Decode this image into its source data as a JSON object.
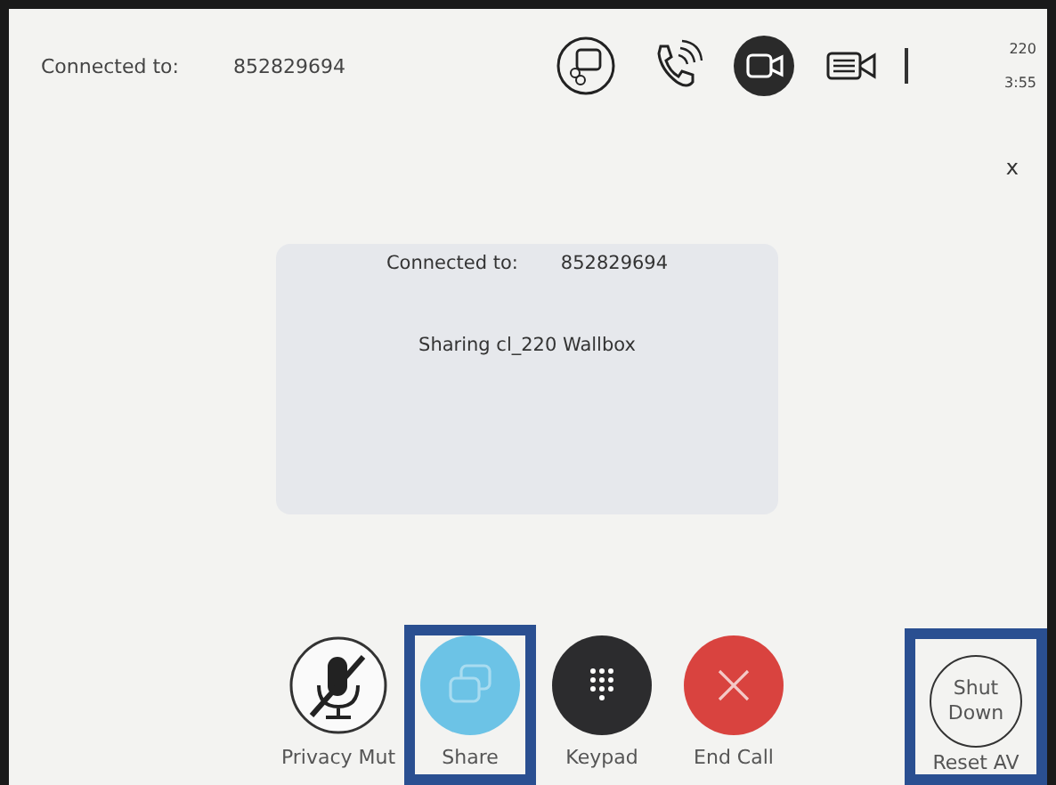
{
  "top_bar": {
    "label": "Connected to:",
    "number": "852829694",
    "icons": [
      {
        "kind": "share-screen",
        "active": false
      },
      {
        "kind": "phone",
        "active": false
      },
      {
        "kind": "video",
        "active": true
      },
      {
        "kind": "camera-settings",
        "active": false
      }
    ],
    "room": "220",
    "time": "3:55"
  },
  "close": "x",
  "dialog": {
    "label": "Connected to:",
    "number": "852829694",
    "message": "Sharing cl_220 Wallbox"
  },
  "controls": [
    {
      "kind": "mute",
      "label": "Privacy Mut",
      "highlighted": false
    },
    {
      "kind": "share",
      "label": "Share",
      "highlighted": true
    },
    {
      "kind": "keypad",
      "label": "Keypad",
      "highlighted": false
    },
    {
      "kind": "end",
      "label": "End Call",
      "highlighted": false
    }
  ],
  "shutdown": {
    "text": "Shut Down",
    "label": "Reset AV",
    "highlighted": true
  }
}
